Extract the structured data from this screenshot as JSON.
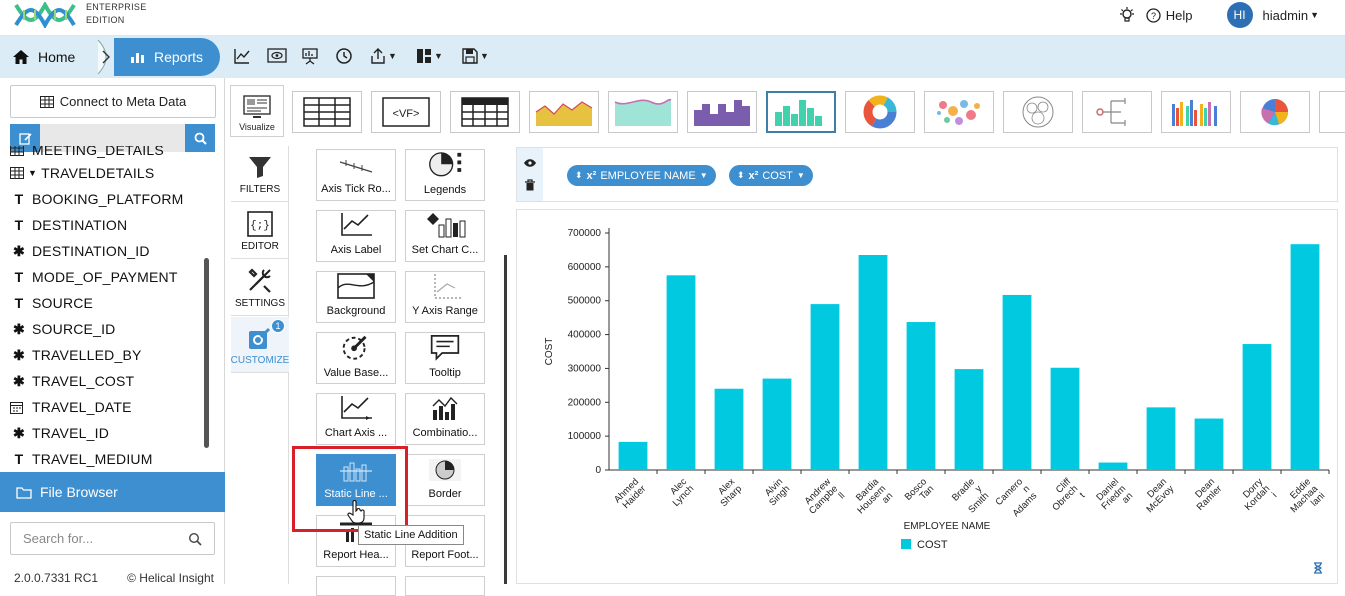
{
  "header": {
    "edition_line1": "ENTERPRISE",
    "edition_line2": "EDITION",
    "help": "Help",
    "avatar_initials": "HI",
    "username": "hiadmin"
  },
  "toolbar": {
    "home": "Home",
    "reports": "Reports"
  },
  "left": {
    "connect": "Connect to Meta Data",
    "tree": [
      {
        "icon": "table-icon",
        "label": "MEETING_DETAILS"
      },
      {
        "icon": "table-icon",
        "label": "TRAVELDETAILS",
        "expanded": true
      },
      {
        "icon": "text-icon",
        "label": "BOOKING_PLATFORM"
      },
      {
        "icon": "text-icon",
        "label": "DESTINATION"
      },
      {
        "icon": "gear-icon",
        "label": "DESTINATION_ID"
      },
      {
        "icon": "text-icon",
        "label": "MODE_OF_PAYMENT"
      },
      {
        "icon": "text-icon",
        "label": "SOURCE"
      },
      {
        "icon": "gear-icon",
        "label": "SOURCE_ID"
      },
      {
        "icon": "gear-icon",
        "label": "TRAVELLED_BY"
      },
      {
        "icon": "gear-icon",
        "label": "TRAVEL_COST"
      },
      {
        "icon": "calendar-icon",
        "label": "TRAVEL_DATE"
      },
      {
        "icon": "gear-icon",
        "label": "TRAVEL_ID"
      },
      {
        "icon": "text-icon",
        "label": "TRAVEL_MEDIUM"
      }
    ],
    "file_browser": "File Browser",
    "search_placeholder": "Search for...",
    "version": "2.0.0.7331 RC1",
    "copyright": "© Helical Insight"
  },
  "charttypes": {
    "visualize": "Visualize",
    "selected_index": 6
  },
  "sidetabs": [
    {
      "label": "FILTERS",
      "icon": "funnel-icon"
    },
    {
      "label": "EDITOR",
      "icon": "code-braces-icon"
    },
    {
      "label": "SETTINGS",
      "icon": "tools-icon"
    },
    {
      "label": "CUSTOMIZE",
      "icon": "customize-icon",
      "badge": "1",
      "active": true
    }
  ],
  "options": [
    {
      "label": "Axis Tick Ro...",
      "icon": "axis-tick-icon"
    },
    {
      "label": "Legends",
      "icon": "legends-icon"
    },
    {
      "label": "Axis Label",
      "icon": "axis-label-icon"
    },
    {
      "label": "Set Chart C...",
      "icon": "paint-bucket-icon"
    },
    {
      "label": "Background",
      "icon": "background-icon"
    },
    {
      "label": "Y Axis Range",
      "icon": "y-axis-range-icon"
    },
    {
      "label": "Value Base...",
      "icon": "value-based-icon"
    },
    {
      "label": "Tooltip",
      "icon": "tooltip-icon"
    },
    {
      "label": "Chart Axis ...",
      "icon": "chart-axis-icon"
    },
    {
      "label": "Combinatio...",
      "icon": "combination-icon"
    },
    {
      "label": "Static Line ...",
      "icon": "static-line-icon",
      "highlighted": true
    },
    {
      "label": "Border",
      "icon": "border-icon"
    },
    {
      "label": "Report Hea...",
      "icon": "report-header-icon"
    },
    {
      "label": "Report Foot...",
      "icon": "report-footer-icon"
    }
  ],
  "tooltip": "Static Line Addition",
  "fields": [
    {
      "label": "EMPLOYEE NAME"
    },
    {
      "label": "COST"
    }
  ],
  "colors": {
    "accent": "#3d8fd0",
    "bar": "#00c9e0",
    "highlight_box": "#d9202a"
  },
  "chart_data": {
    "type": "bar",
    "xlabel": "EMPLOYEE NAME",
    "ylabel": "COST",
    "ylim": [
      0,
      700000
    ],
    "yticks": [
      0,
      100000,
      200000,
      300000,
      400000,
      500000,
      600000,
      700000
    ],
    "categories": [
      "Ahmed Haider",
      "Alec Lynch",
      "Alex Sharp",
      "Alvin Singh",
      "Andrew Campbell",
      "Bardia Housseman",
      "Bosco Tan",
      "Bradley Smith",
      "Cameron Adams",
      "Cliff Obrecht",
      "Daniel Friedman",
      "Dean McEvoy",
      "Dean Ramler",
      "Dorry Kordahi",
      "Eddie Machaalani"
    ],
    "tick_lines": [
      [
        "Ahmed",
        "Haider"
      ],
      [
        "Alec",
        "Lynch"
      ],
      [
        "Alex",
        "Sharp"
      ],
      [
        "Alvin",
        "Singh"
      ],
      [
        "Andrew",
        "Campbe",
        "ll"
      ],
      [
        "Bardia",
        "Housem",
        "an"
      ],
      [
        "Bosco",
        "Tan"
      ],
      [
        "Bradle",
        "y",
        "Smith"
      ],
      [
        "Camero",
        "n",
        "Adams"
      ],
      [
        "Cliff",
        "Obrech",
        "t"
      ],
      [
        "Daniel",
        "Friedm",
        "an"
      ],
      [
        "Dean",
        "McEvoy"
      ],
      [
        "Dean",
        "Ramler"
      ],
      [
        "Dorry",
        "Kordah",
        "i"
      ],
      [
        "Eddie",
        "Machaa",
        "lani"
      ]
    ],
    "series": [
      {
        "name": "COST",
        "values": [
          83000,
          575000,
          240000,
          270000,
          490000,
          635000,
          437000,
          298000,
          517000,
          302000,
          22000,
          185000,
          152000,
          372000,
          667000
        ]
      }
    ],
    "legend": "bottom-left",
    "grid": false
  }
}
